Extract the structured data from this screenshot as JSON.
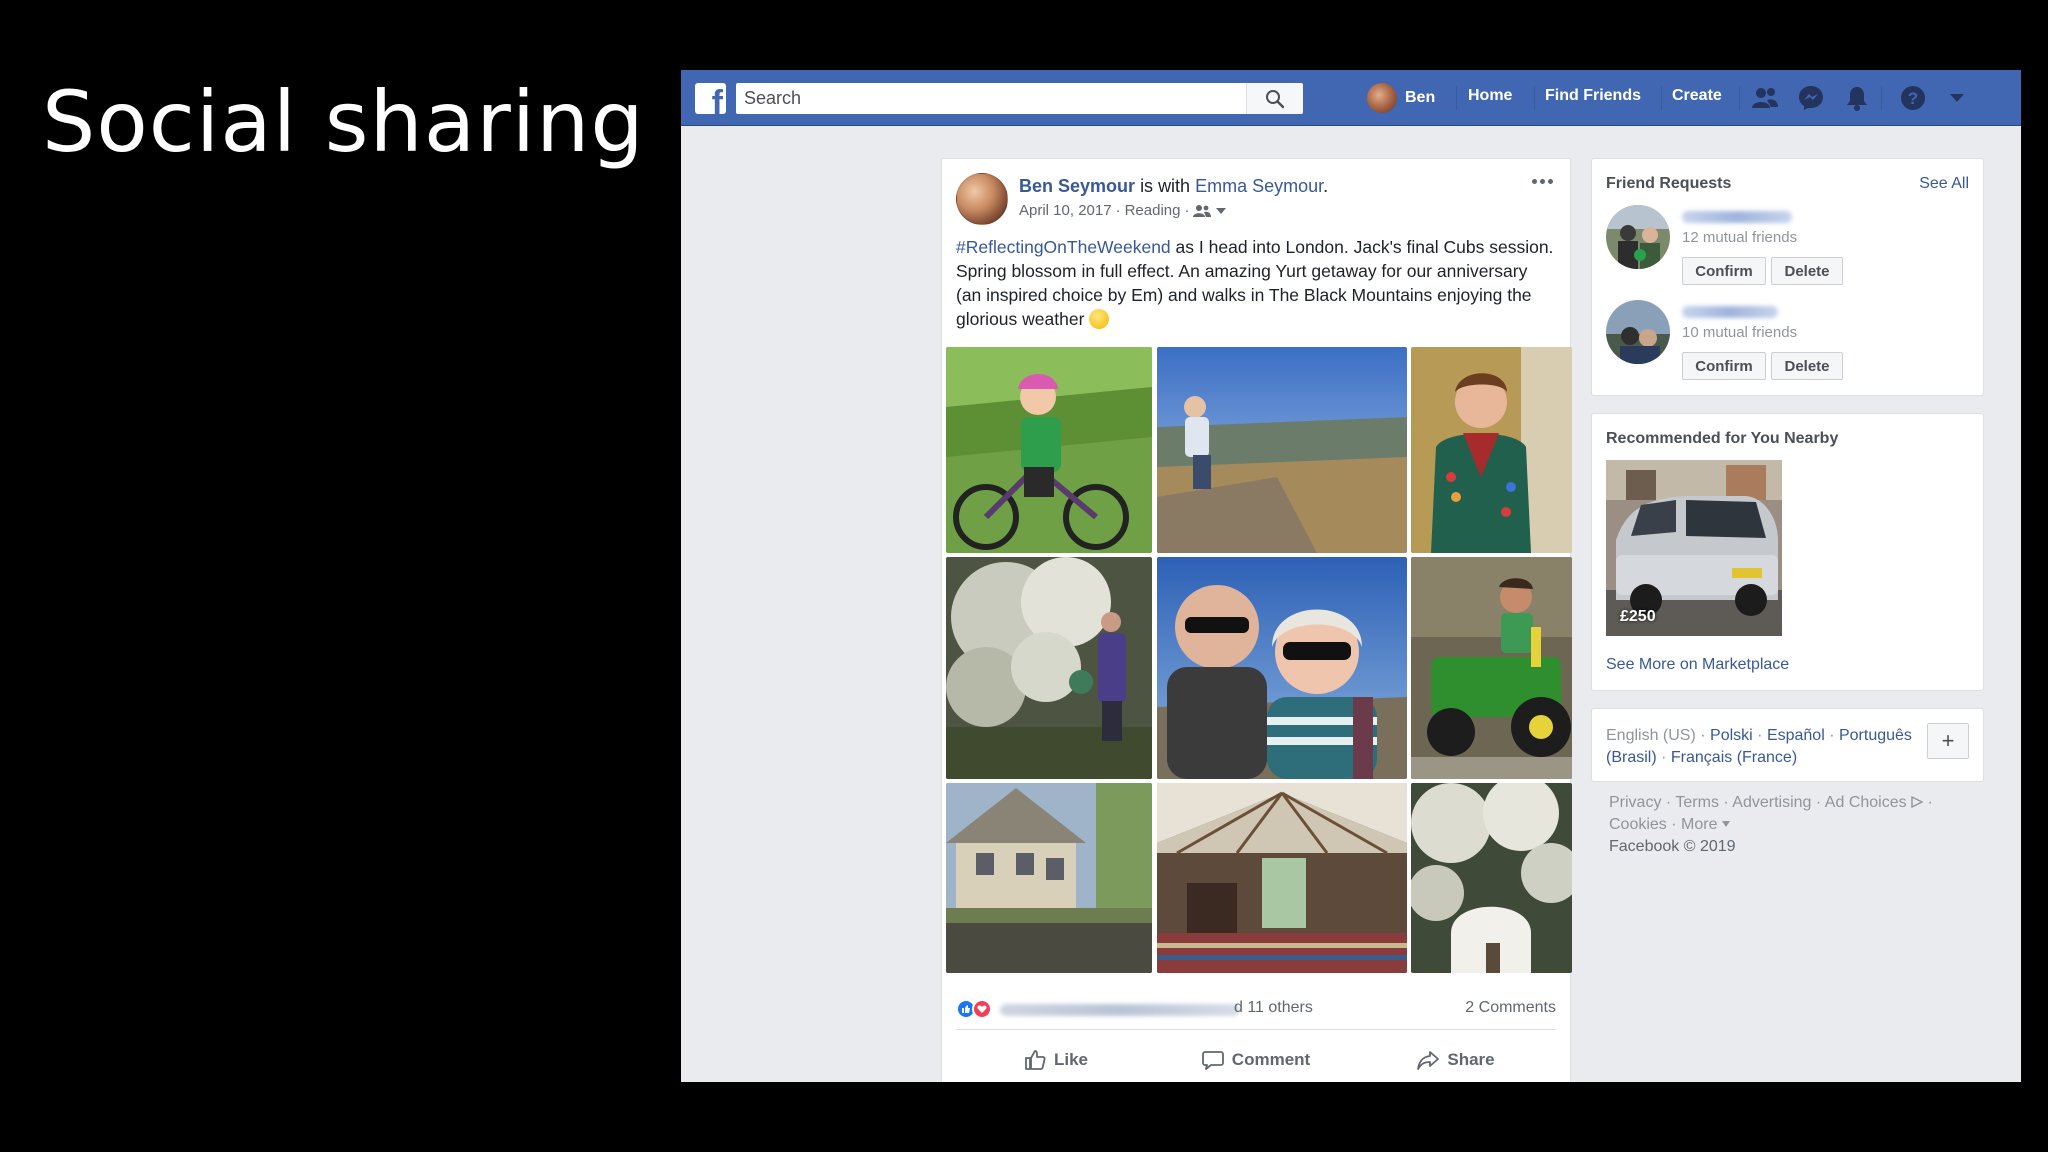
{
  "slide": {
    "title": "Social sharing"
  },
  "topbar": {
    "search_placeholder": "Search",
    "user_name": "Ben",
    "nav": {
      "home": "Home",
      "find_friends": "Find Friends",
      "create": "Create"
    }
  },
  "post": {
    "author": "Ben Seymour",
    "with_text": "is with",
    "tagged": "Emma Seymour",
    "date": "April 10, 2017",
    "location": "Reading",
    "hashtag": "#ReflectingOnTheWeekend",
    "body": "as I head into London. Jack's final Cubs session. Spring blossom in full effect. An amazing Yurt getaway for our anniversary (an inspired choice by Em) and walks in The Black Mountains enjoying the glorious weather",
    "reactions_text": "d 11 others",
    "comments_count": "2 Comments",
    "actions": {
      "like": "Like",
      "comment": "Comment",
      "share": "Share"
    }
  },
  "friend_requests": {
    "title": "Friend Requests",
    "see_all": "See All",
    "items": [
      {
        "mutual": "12 mutual friends",
        "confirm": "Confirm",
        "delete": "Delete"
      },
      {
        "mutual": "10 mutual friends",
        "confirm": "Confirm",
        "delete": "Delete"
      }
    ]
  },
  "recommended": {
    "title": "Recommended for You Nearby",
    "price": "£250",
    "link": "See More on Marketplace"
  },
  "languages": {
    "current": "English (US)",
    "options": [
      "Polski",
      "Español",
      "Português (Brasil)",
      "Français (France)"
    ]
  },
  "footer": {
    "links": [
      "Privacy",
      "Terms",
      "Advertising",
      "Ad Choices",
      "Cookies",
      "More"
    ],
    "copyright": "Facebook © 2019"
  }
}
